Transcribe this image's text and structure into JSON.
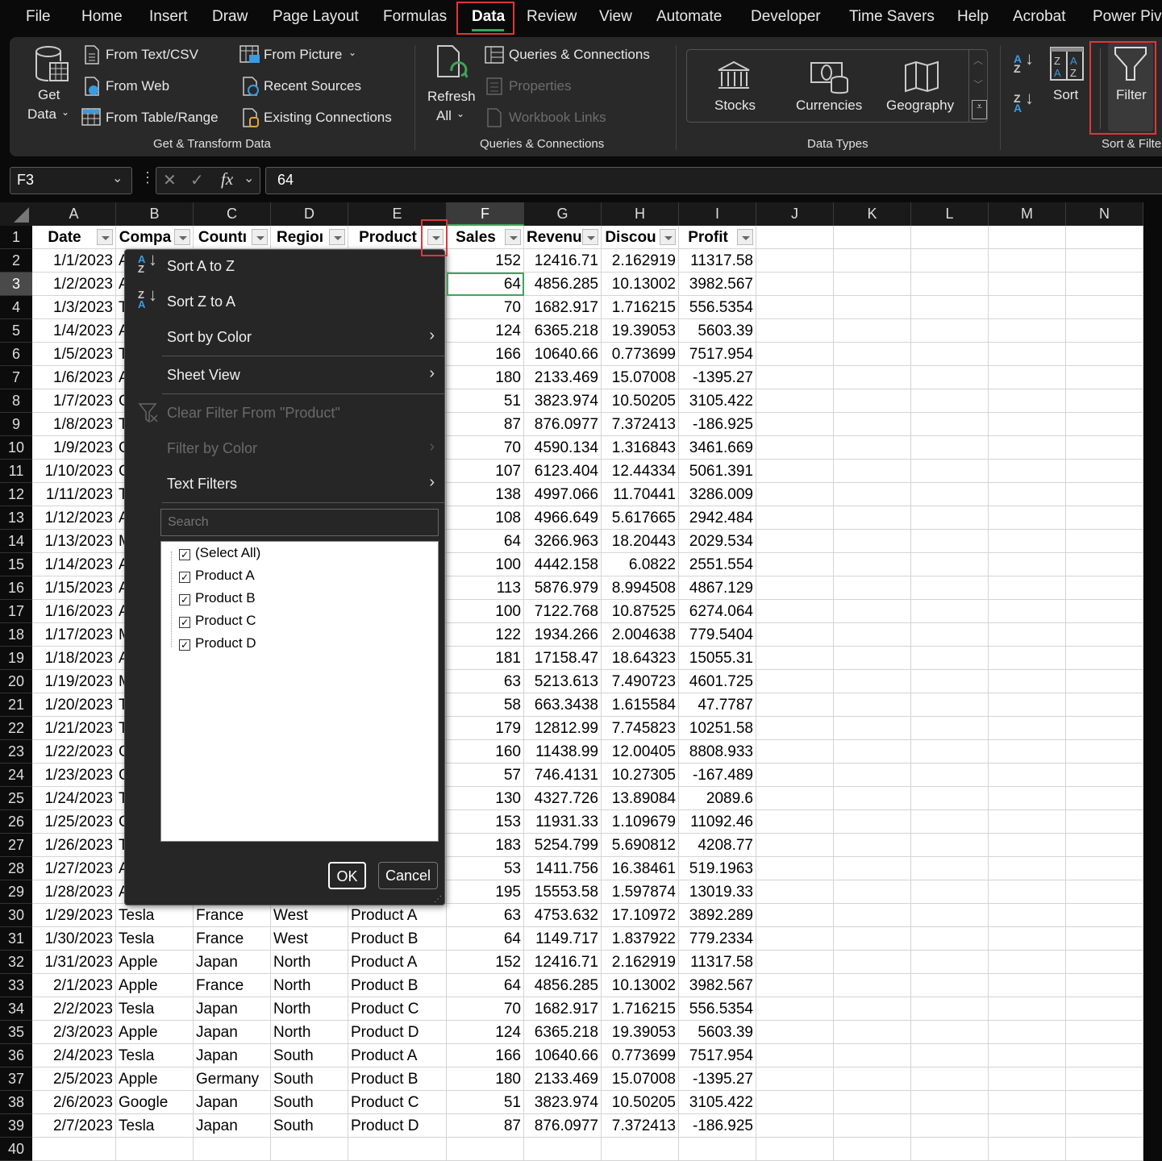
{
  "tabs": [
    "File",
    "Home",
    "Insert",
    "Draw",
    "Page Layout",
    "Formulas",
    "Data",
    "Review",
    "View",
    "Automate",
    "Developer",
    "Time Savers",
    "Help",
    "Acrobat",
    "Power Pivot"
  ],
  "active_tab": "Data",
  "ribbon": {
    "get_data": [
      "Get",
      "Data"
    ],
    "from_text_csv": "From Text/CSV",
    "from_web": "From Web",
    "from_table_range": "From Table/Range",
    "from_picture": "From Picture",
    "recent_sources": "Recent Sources",
    "existing_connections": "Existing Connections",
    "group_get_transform": "Get & Transform Data",
    "refresh_all": [
      "Refresh",
      "All"
    ],
    "queries_connections": "Queries & Connections",
    "properties": "Properties",
    "workbook_links": "Workbook Links",
    "group_queries": "Queries & Connections",
    "stocks": "Stocks",
    "currencies": "Currencies",
    "geography": "Geography",
    "group_data_types": "Data Types",
    "sort": "Sort",
    "filter": "Filter",
    "group_sort_filter": "Sort & Filter"
  },
  "formula_bar": {
    "name_box": "F3",
    "fx": "fx",
    "value": "64"
  },
  "columns": [
    "A",
    "B",
    "C",
    "D",
    "E",
    "F",
    "G",
    "H",
    "I",
    "J",
    "K",
    "L",
    "M",
    "N"
  ],
  "selected_cell": "F3",
  "headers": [
    "Date",
    "Compa",
    "Countı",
    "Regioı",
    "Product",
    "Sales",
    "Revenu",
    "Discou",
    "Profit"
  ],
  "rows": [
    [
      "1/1/2023",
      "A",
      "",
      "",
      "",
      "152",
      "12416.71",
      "2.162919",
      "11317.58"
    ],
    [
      "1/2/2023",
      "A",
      "",
      "",
      "",
      "64",
      "4856.285",
      "10.13002",
      "3982.567"
    ],
    [
      "1/3/2023",
      "T",
      "",
      "",
      "",
      "70",
      "1682.917",
      "1.716215",
      "556.5354"
    ],
    [
      "1/4/2023",
      "A",
      "",
      "",
      "",
      "124",
      "6365.218",
      "19.39053",
      "5603.39"
    ],
    [
      "1/5/2023",
      "T",
      "",
      "",
      "",
      "166",
      "10640.66",
      "0.773699",
      "7517.954"
    ],
    [
      "1/6/2023",
      "A",
      "",
      "",
      "",
      "180",
      "2133.469",
      "15.07008",
      "-1395.27"
    ],
    [
      "1/7/2023",
      "G",
      "",
      "",
      "",
      "51",
      "3823.974",
      "10.50205",
      "3105.422"
    ],
    [
      "1/8/2023",
      "T",
      "",
      "",
      "",
      "87",
      "876.0977",
      "7.372413",
      "-186.925"
    ],
    [
      "1/9/2023",
      "G",
      "",
      "",
      "",
      "70",
      "4590.134",
      "1.316843",
      "3461.669"
    ],
    [
      "1/10/2023",
      "G",
      "",
      "",
      "",
      "107",
      "6123.404",
      "12.44334",
      "5061.391"
    ],
    [
      "1/11/2023",
      "T",
      "",
      "",
      "",
      "138",
      "4997.066",
      "11.70441",
      "3286.009"
    ],
    [
      "1/12/2023",
      "A",
      "",
      "",
      "",
      "108",
      "4966.649",
      "5.617665",
      "2942.484"
    ],
    [
      "1/13/2023",
      "M",
      "",
      "",
      "",
      "64",
      "3266.963",
      "18.20443",
      "2029.534"
    ],
    [
      "1/14/2023",
      "A",
      "",
      "",
      "",
      "100",
      "4442.158",
      "6.0822",
      "2551.554"
    ],
    [
      "1/15/2023",
      "A",
      "",
      "",
      "",
      "113",
      "5876.979",
      "8.994508",
      "4867.129"
    ],
    [
      "1/16/2023",
      "A",
      "",
      "",
      "",
      "100",
      "7122.768",
      "10.87525",
      "6274.064"
    ],
    [
      "1/17/2023",
      "M",
      "",
      "",
      "",
      "122",
      "1934.266",
      "2.004638",
      "779.5404"
    ],
    [
      "1/18/2023",
      "A",
      "",
      "",
      "",
      "181",
      "17158.47",
      "18.64323",
      "15055.31"
    ],
    [
      "1/19/2023",
      "M",
      "",
      "",
      "",
      "63",
      "5213.613",
      "7.490723",
      "4601.725"
    ],
    [
      "1/20/2023",
      "T",
      "",
      "",
      "",
      "58",
      "663.3438",
      "1.615584",
      "47.7787"
    ],
    [
      "1/21/2023",
      "T",
      "",
      "",
      "",
      "179",
      "12812.99",
      "7.745823",
      "10251.58"
    ],
    [
      "1/22/2023",
      "G",
      "",
      "",
      "",
      "160",
      "11438.99",
      "12.00405",
      "8808.933"
    ],
    [
      "1/23/2023",
      "G",
      "",
      "",
      "",
      "57",
      "746.4131",
      "10.27305",
      "-167.489"
    ],
    [
      "1/24/2023",
      "T",
      "",
      "",
      "",
      "130",
      "4327.726",
      "13.89084",
      "2089.6"
    ],
    [
      "1/25/2023",
      "G",
      "",
      "",
      "",
      "153",
      "11931.33",
      "1.109679",
      "11092.46"
    ],
    [
      "1/26/2023",
      "T",
      "",
      "",
      "",
      "183",
      "5254.799",
      "5.690812",
      "4208.77"
    ],
    [
      "1/27/2023",
      "A",
      "",
      "",
      "",
      "53",
      "1411.756",
      "16.38461",
      "519.1963"
    ],
    [
      "1/28/2023",
      "A",
      "",
      "",
      "",
      "195",
      "15553.58",
      "1.597874",
      "13019.33"
    ],
    [
      "1/29/2023",
      "Tesla",
      "France",
      "West",
      "Product A",
      "63",
      "4753.632",
      "17.10972",
      "3892.289"
    ],
    [
      "1/30/2023",
      "Tesla",
      "France",
      "West",
      "Product B",
      "64",
      "1149.717",
      "1.837922",
      "779.2334"
    ],
    [
      "1/31/2023",
      "Apple",
      "Japan",
      "North",
      "Product A",
      "152",
      "12416.71",
      "2.162919",
      "11317.58"
    ],
    [
      "2/1/2023",
      "Apple",
      "France",
      "North",
      "Product B",
      "64",
      "4856.285",
      "10.13002",
      "3982.567"
    ],
    [
      "2/2/2023",
      "Tesla",
      "Japan",
      "North",
      "Product C",
      "70",
      "1682.917",
      "1.716215",
      "556.5354"
    ],
    [
      "2/3/2023",
      "Apple",
      "Japan",
      "North",
      "Product D",
      "124",
      "6365.218",
      "19.39053",
      "5603.39"
    ],
    [
      "2/4/2023",
      "Tesla",
      "Japan",
      "South",
      "Product A",
      "166",
      "10640.66",
      "0.773699",
      "7517.954"
    ],
    [
      "2/5/2023",
      "Apple",
      "Germany",
      "South",
      "Product B",
      "180",
      "2133.469",
      "15.07008",
      "-1395.27"
    ],
    [
      "2/6/2023",
      "Google",
      "Japan",
      "South",
      "Product C",
      "51",
      "3823.974",
      "10.50205",
      "3105.422"
    ],
    [
      "2/7/2023",
      "Tesla",
      "Japan",
      "South",
      "Product D",
      "87",
      "876.0977",
      "7.372413",
      "-186.925"
    ]
  ],
  "filter_menu": {
    "sort_az": "Sort A to Z",
    "sort_za": "Sort Z to A",
    "sort_by_color": "Sort by Color",
    "sheet_view": "Sheet View",
    "clear_filter": "Clear Filter From \"Product\"",
    "filter_by_color": "Filter by Color",
    "text_filters": "Text Filters",
    "search_placeholder": "Search",
    "items": [
      {
        "label": "(Select All)",
        "checked": true
      },
      {
        "label": "Product A",
        "checked": true
      },
      {
        "label": "Product B",
        "checked": true
      },
      {
        "label": "Product C",
        "checked": true
      },
      {
        "label": "Product D",
        "checked": true
      }
    ],
    "ok": "OK",
    "cancel": "Cancel"
  },
  "colors": {
    "accent_green": "#3fa45a",
    "highlight_red": "#e0363a",
    "icon_blue": "#3a9be0"
  }
}
